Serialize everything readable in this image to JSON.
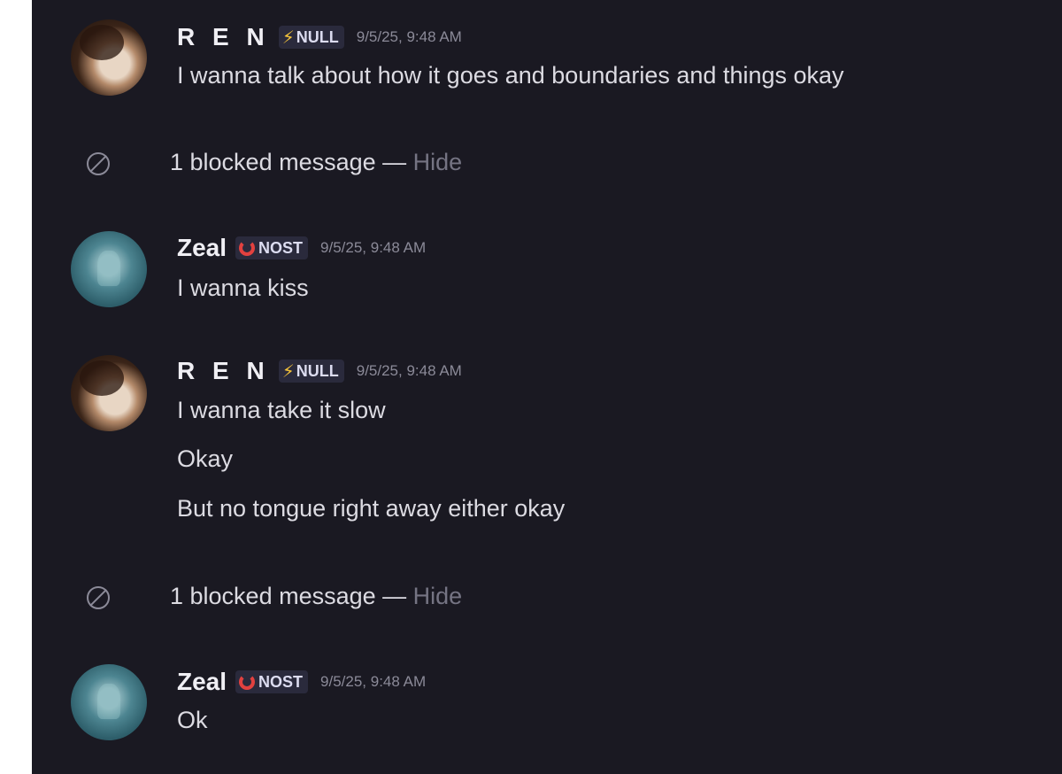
{
  "messages": [
    {
      "author": "R E N",
      "tag": "NULL",
      "tag_icon": "lightning-bolt-icon",
      "timestamp": "9/5/25, 9:48 AM",
      "lines": [
        "I wanna talk about how it goes and boundaries and things okay"
      ]
    },
    {
      "author": "Zeal",
      "tag": "NOST",
      "tag_icon": "red-ring-icon",
      "timestamp": "9/5/25, 9:48 AM",
      "lines": [
        "I wanna kiss"
      ]
    },
    {
      "author": "R E N",
      "tag": "NULL",
      "tag_icon": "lightning-bolt-icon",
      "timestamp": "9/5/25, 9:48 AM",
      "lines": [
        "I wanna take it slow",
        "Okay",
        "But no tongue right away either okay"
      ]
    },
    {
      "author": "Zeal",
      "tag": "NOST",
      "tag_icon": "red-ring-icon",
      "timestamp": "9/5/25, 9:48 AM",
      "lines": [
        "Ok"
      ]
    }
  ],
  "blocked": [
    {
      "text": "1 blocked message — ",
      "action": "Hide"
    },
    {
      "text": "1 blocked message — ",
      "action": "Hide"
    }
  ],
  "colors": {
    "background": "#1a1922",
    "bolt": "#f3c23a",
    "ring": "#e2413f",
    "timestamp": "#8b8a98"
  }
}
